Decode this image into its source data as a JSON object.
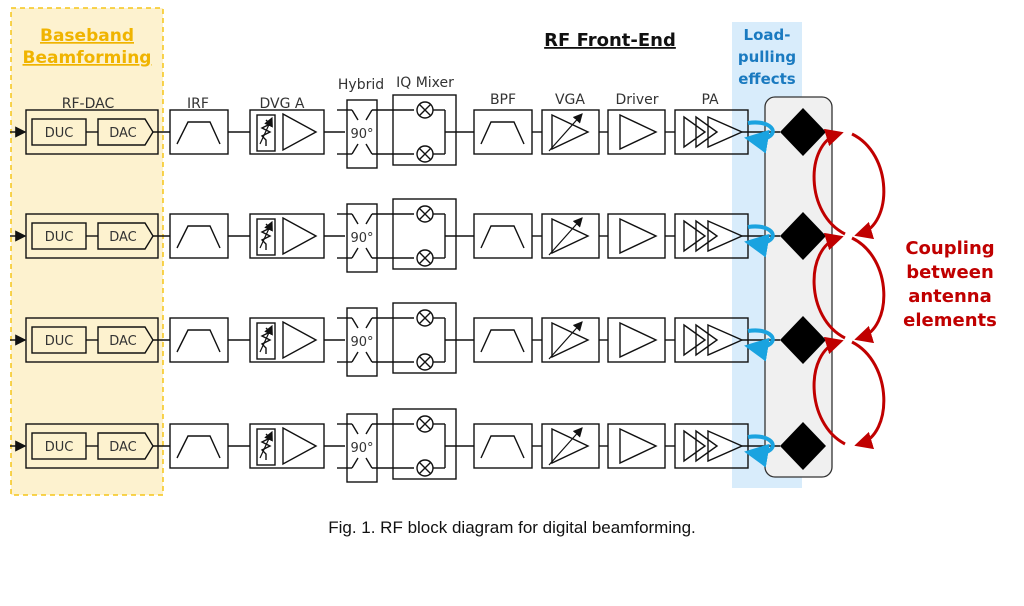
{
  "figure": {
    "caption": "Fig. 1. RF block diagram for digital beamforming.",
    "baseband_title_line1": "Baseband",
    "baseband_title_line2": "Beamforming",
    "rf_frontend_title": "RF Front-End",
    "loadpull_line1": "Load-",
    "loadpull_line2": "pulling",
    "loadpull_line3": "effects",
    "coupling_line1": "Coupling",
    "coupling_line2": "between",
    "coupling_line3": "antenna",
    "coupling_line4": "elements"
  },
  "block_labels": {
    "rfdac": "RF-DAC",
    "irf": "IRF",
    "dvga": "DVG A",
    "hybrid": "Hybrid",
    "iqmixer": "IQ Mixer",
    "bpf": "BPF",
    "vga": "VGA",
    "driver": "Driver",
    "pa": "PA"
  },
  "inner_labels": {
    "duc": "DUC",
    "dac": "DAC",
    "phase": "90°"
  },
  "rows": [
    {
      "id": "chain-1"
    },
    {
      "id": "chain-2"
    },
    {
      "id": "chain-3"
    },
    {
      "id": "chain-4"
    }
  ],
  "colors": {
    "baseband_fill": "#fdf2cf",
    "baseband_border": "#f5c518",
    "baseband_text": "#f0b400",
    "loadpull_fill": "#d8ecfb",
    "loadpull_text": "#1a7ac0",
    "loadpull_arrow": "#1aa3e0",
    "coupling": "#c00000",
    "antenna_panel": "#f0f0f0"
  }
}
